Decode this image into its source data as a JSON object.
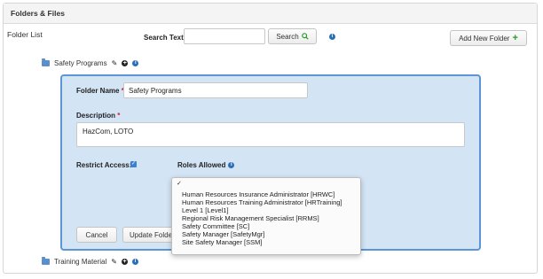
{
  "header": {
    "title": "Folders & Files"
  },
  "toolbar": {
    "folder_list_label": "Folder List",
    "search_label": "Search Text",
    "search_value": "",
    "search_button": "Search",
    "add_button": "Add New Folder"
  },
  "folders": [
    {
      "name": "Safety Programs"
    },
    {
      "name": "Training Material"
    }
  ],
  "edit_form": {
    "folder_name_label": "Folder Name",
    "folder_name_value": "Safety Programs",
    "description_label": "Description",
    "description_value": "HazCom, LOTO",
    "restrict_label": "Restrict Access:",
    "restrict_checked": true,
    "roles_label": "Roles Allowed",
    "cancel_button": "Cancel",
    "update_button": "Update Folder"
  },
  "roles_dropdown": {
    "selected": "✓",
    "options": [
      "Human Resources Insurance Administrator [HRWC]",
      "Human Resources Training Administrator [HRTraining]",
      "Level 1 [Level1]",
      "Regional Risk Management Specialist [RRMS]",
      "Safety Committee [SC]",
      "Safety Manager [SafetyMgr]",
      "Site Safety Manager [SSM]"
    ]
  },
  "colors": {
    "accent": "#5b95d6",
    "form_background": "#d3e4f5",
    "folder_icon": "#5b8fc9",
    "add_icon": "#2d9a2d",
    "info_icon": "#2a6fb8"
  }
}
